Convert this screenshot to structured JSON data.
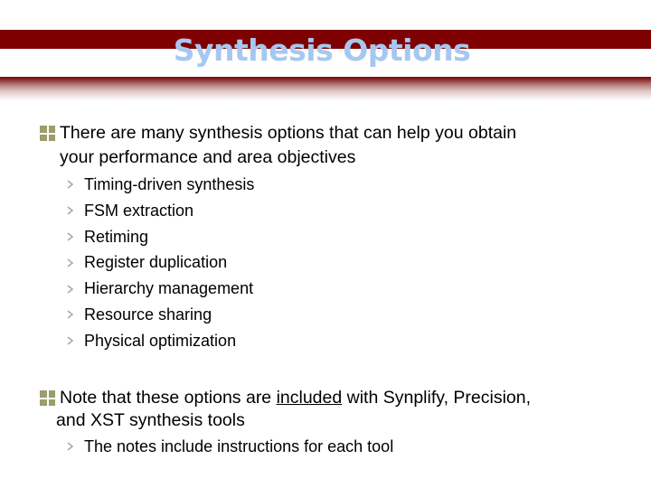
{
  "slide": {
    "title": "Synthesis Options",
    "colors": {
      "header_band": "#7f0000",
      "title": "#a6c8f0",
      "bullet": "#9c9c6c",
      "sub_bullet": "#b0aaa0"
    },
    "items": [
      {
        "line1": "There are many synthesis options that can help you obtain",
        "line2": "your performance and area objectives",
        "subitems": [
          "Timing-driven synthesis",
          "FSM extraction",
          "Retiming",
          "Register duplication",
          "Hierarchy management",
          "Resource sharing",
          "Physical optimization"
        ]
      },
      {
        "line1_pre": "Note that these options are ",
        "line1_underlined": "included",
        "line1_post": " with Synplify, Precision,",
        "line2": "and XST synthesis tools",
        "subitems": [
          "The notes include instructions for each tool"
        ]
      }
    ]
  }
}
